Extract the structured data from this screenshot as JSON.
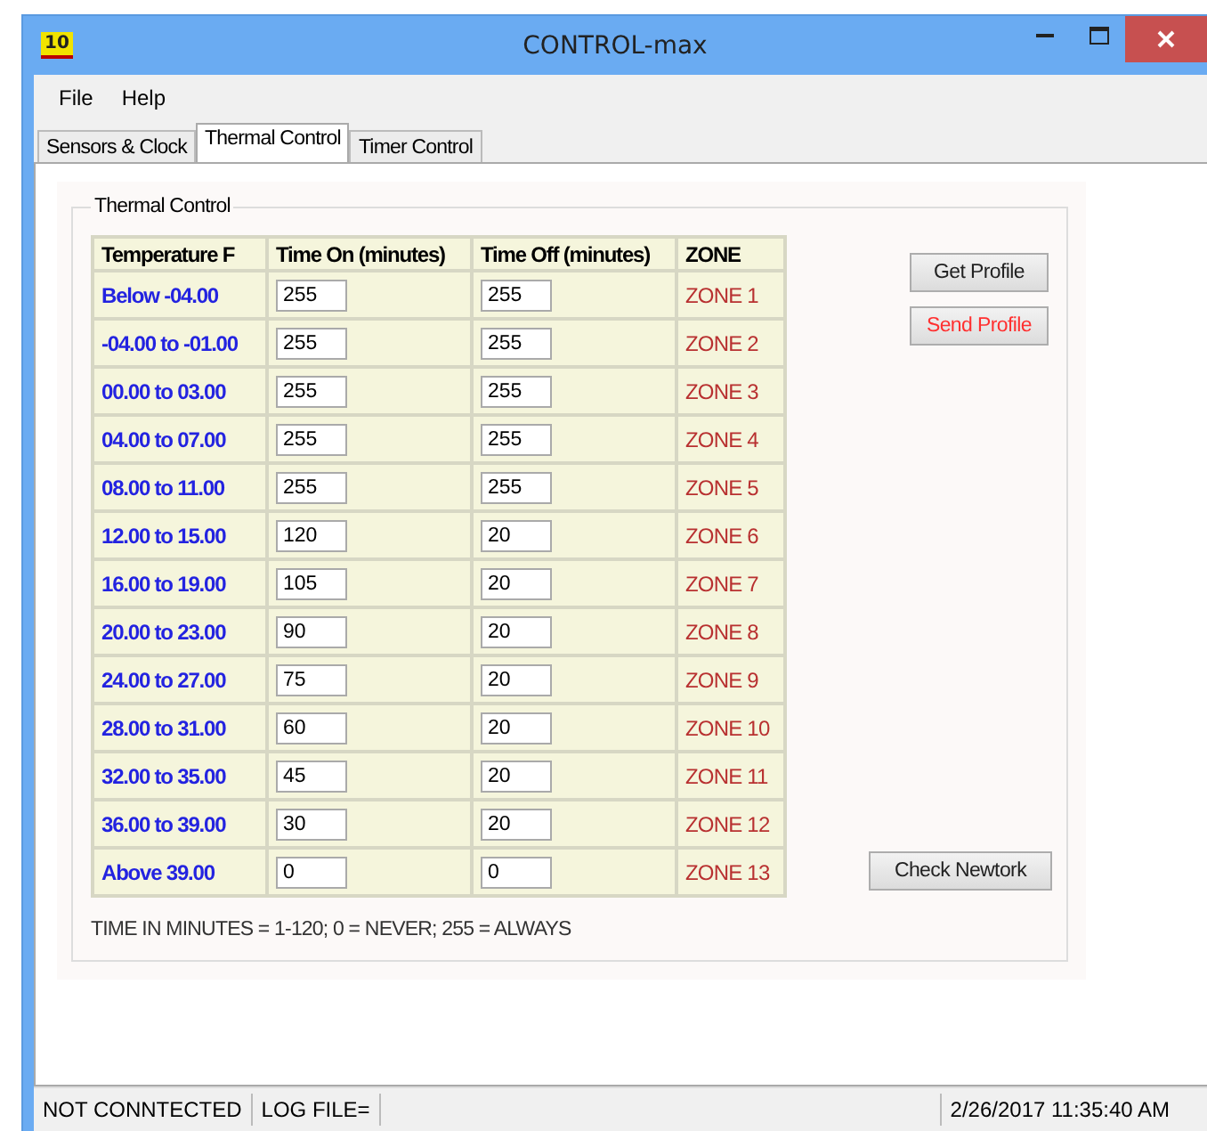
{
  "window": {
    "app_badge": "10",
    "title": "CONTROL-max"
  },
  "menu": [
    "File",
    "Help"
  ],
  "tabs": [
    {
      "label": "Sensors & Clock",
      "selected": false
    },
    {
      "label": "Thermal Control",
      "selected": true
    },
    {
      "label": "Timer Control",
      "selected": false
    }
  ],
  "group": {
    "title": "Thermal Control",
    "table": {
      "columns": [
        "Temperature F",
        "Time On (minutes)",
        "Time Off (minutes)",
        "ZONE"
      ],
      "rows": [
        {
          "temperature": "Below -04.00",
          "time_on": "255",
          "time_off": "255",
          "zone": "ZONE 1"
        },
        {
          "temperature": "-04.00 to -01.00",
          "time_on": "255",
          "time_off": "255",
          "zone": "ZONE 2"
        },
        {
          "temperature": "00.00 to 03.00",
          "time_on": "255",
          "time_off": "255",
          "zone": "ZONE 3"
        },
        {
          "temperature": "04.00 to 07.00",
          "time_on": "255",
          "time_off": "255",
          "zone": "ZONE 4"
        },
        {
          "temperature": "08.00 to 11.00",
          "time_on": "255",
          "time_off": "255",
          "zone": "ZONE 5"
        },
        {
          "temperature": "12.00 to 15.00",
          "time_on": "120",
          "time_off": "20",
          "zone": "ZONE 6"
        },
        {
          "temperature": "16.00 to 19.00",
          "time_on": "105",
          "time_off": "20",
          "zone": "ZONE 7"
        },
        {
          "temperature": "20.00 to 23.00",
          "time_on": "90",
          "time_off": "20",
          "zone": "ZONE 8"
        },
        {
          "temperature": "24.00 to 27.00",
          "time_on": "75",
          "time_off": "20",
          "zone": "ZONE 9"
        },
        {
          "temperature": "28.00 to 31.00",
          "time_on": "60",
          "time_off": "20",
          "zone": "ZONE 10"
        },
        {
          "temperature": "32.00 to 35.00",
          "time_on": "45",
          "time_off": "20",
          "zone": "ZONE 11"
        },
        {
          "temperature": "36.00 to 39.00",
          "time_on": "30",
          "time_off": "20",
          "zone": "ZONE 12"
        },
        {
          "temperature": "Above 39.00",
          "time_on": "0",
          "time_off": "0",
          "zone": "ZONE 13"
        }
      ]
    },
    "top_buttons": [
      {
        "label": "Get Profile",
        "kind": "normal"
      },
      {
        "label": "Send Profile",
        "kind": "warning"
      }
    ],
    "bottom_button": {
      "label": "Check Newtork"
    },
    "note": "TIME IN MINUTES  = 1-120;  0 = NEVER;  255 = ALWAYS"
  },
  "status_bar": {
    "connection": "NOT CONNTECTED",
    "log_file": "LOG FILE=",
    "datetime": "2/26/2017 11:35:40 AM"
  }
}
